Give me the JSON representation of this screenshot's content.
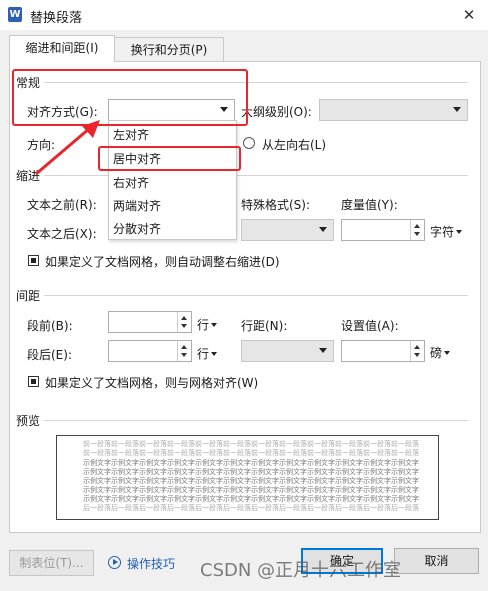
{
  "window": {
    "title": "替换段落",
    "app_icon": "W",
    "close_label": "✕"
  },
  "tabs": [
    {
      "label": "缩进和间距(I)"
    },
    {
      "label": "换行和分页(P)"
    }
  ],
  "general": {
    "section": "常规",
    "align_label": "对齐方式(G):",
    "align_value": "",
    "outline_label": "大纲级别(O):",
    "outline_value": "",
    "direction_label": "方向:",
    "direction_option": "从左向右(L)"
  },
  "align_dropdown": {
    "options": [
      "左对齐",
      "居中对齐",
      "右对齐",
      "两端对齐",
      "分散对齐"
    ],
    "highlighted": "居中对齐"
  },
  "indent": {
    "section": "缩进",
    "before_label": "文本之前(R):",
    "after_label": "文本之后(X):",
    "special_label": "特殊格式(S):",
    "measure_label": "度量值(Y):",
    "measure_unit": "字符",
    "grid_check": "如果定义了文档网格，则自动调整右缩进(D)"
  },
  "spacing": {
    "section": "间距",
    "before_label": "段前(B):",
    "before_unit": "行",
    "after_label": "段后(E):",
    "after_unit": "行",
    "line_label": "行距(N):",
    "setting_label": "设置值(A):",
    "setting_unit": "磅",
    "grid_check": "如果定义了文档网格，则与网格对齐(W)"
  },
  "preview": {
    "section": "预览",
    "lines": [
      "前一段落前一段落前一段落前一段落前一段落前一段落前一段落前一段落前一段落前一段落前一段落前一段落",
      "前一段落前一段落前一段落前一段落前一段落前一段落前一段落前一段落前一段落前一段落前一段落前一段落",
      "示例文字示例文字示例文字示例文字示例文字示例文字示例文字示例文字示例文字示例文字示例文字示例文字",
      "示例文字示例文字示例文字示例文字示例文字示例文字示例文字示例文字示例文字示例文字示例文字示例文字",
      "示例文字示例文字示例文字示例文字示例文字示例文字示例文字示例文字示例文字示例文字示例文字示例文字",
      "示例文字示例文字示例文字示例文字示例文字示例文字示例文字示例文字示例文字示例文字示例文字示例文字",
      "示例文字示例文字示例文字示例文字示例文字示例文字示例文字示例文字示例文字示例文字示例文字示例文字",
      "后一段落后一段落后一段落后一段落后一段落后一段落后一段落后一段落后一段落后一段落后一段落后一段落"
    ]
  },
  "footer": {
    "tabs_button": "制表位(T)...",
    "tips_link": "操作技巧",
    "ok_button": "确定",
    "cancel_button": "取消"
  },
  "watermark": "CSDN @正月十六工作室",
  "colors": {
    "annotation_red": "#e8262b",
    "link_blue": "#1f5fb8",
    "focus_blue": "#0078d7"
  }
}
